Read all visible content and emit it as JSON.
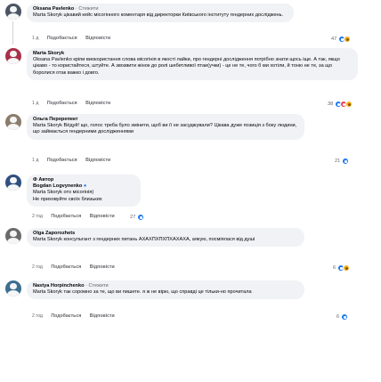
{
  "comments": [
    {
      "author": "Oksana Pavlenko",
      "author_extra": "· Стежити",
      "text": "Marta Skoryk цікавий кейс місогінного коментаря від директорки Київського інституту гендерних досліджень.",
      "time": "1 д",
      "like": "Подобається",
      "reply": "Відповісти",
      "reaction_count": "47"
    },
    {
      "author": "Marta Skoryk",
      "author_extra": "",
      "text": "Oksana Pavlenko кріпи виокористання слова місогінія в якості лайки, про гендерні дослідження потрібно знати щось іще. А так, якщо цікаво - то користайтеся, штуйте. А звозвити жінок до ролі шебетливої птаи(учки) - це не те, чого б ми хотіли, й тоню не те, за що боролися отак важко і довго.",
      "time": "1 д",
      "like": "Подобається",
      "reply": "Відповісти",
      "reaction_count": "38"
    },
    {
      "author": "Ольга Перерепект",
      "author_extra": "",
      "text": "Marta Skoryk Вёдуй! що, голос треба було змінити, щоб ви її не засуджували? Цікава дуже позиція з боку людини, що займається гендерними дослідженнями",
      "time": "1 д",
      "like": "Подобається",
      "reply": "Відповісти",
      "reaction_count": "21"
    },
    {
      "author": "Ф Автор",
      "author_extra": "",
      "line2": "Bogdan Logvynenko",
      "line3": "Marta Skoryk ото місогінія)",
      "line4": "Не приховуйте своїх близьких",
      "time": "2 год",
      "like": "Подобається",
      "reply": "Відповісти",
      "reaction_count": "27"
    },
    {
      "author": "Olga Zaporozhets",
      "author_extra": "",
      "text": "Marta Skoryk консультант з гендерних питань АХАХПХПХПХАХАХА, аякую, посміялася від душі",
      "time": "2 год",
      "like": "Подобається",
      "reply": "Відповісти",
      "reaction_count": "6"
    },
    {
      "author": "Nastya Horpinchenko",
      "author_extra": "· Стежити",
      "text": "Marta Skoryk так соромно за те, що ви пишете. я ж не вірю, що справді це тільки-но прочитала",
      "time": "2 год",
      "like": "Подобається",
      "reply": "Відповісти",
      "reaction_count": "6"
    }
  ],
  "colors": {
    "bubble": "#f0f2f5",
    "like": "#1877f2",
    "love": "#f33e58",
    "care": "#f7b125",
    "meta_text": "#65676b"
  }
}
